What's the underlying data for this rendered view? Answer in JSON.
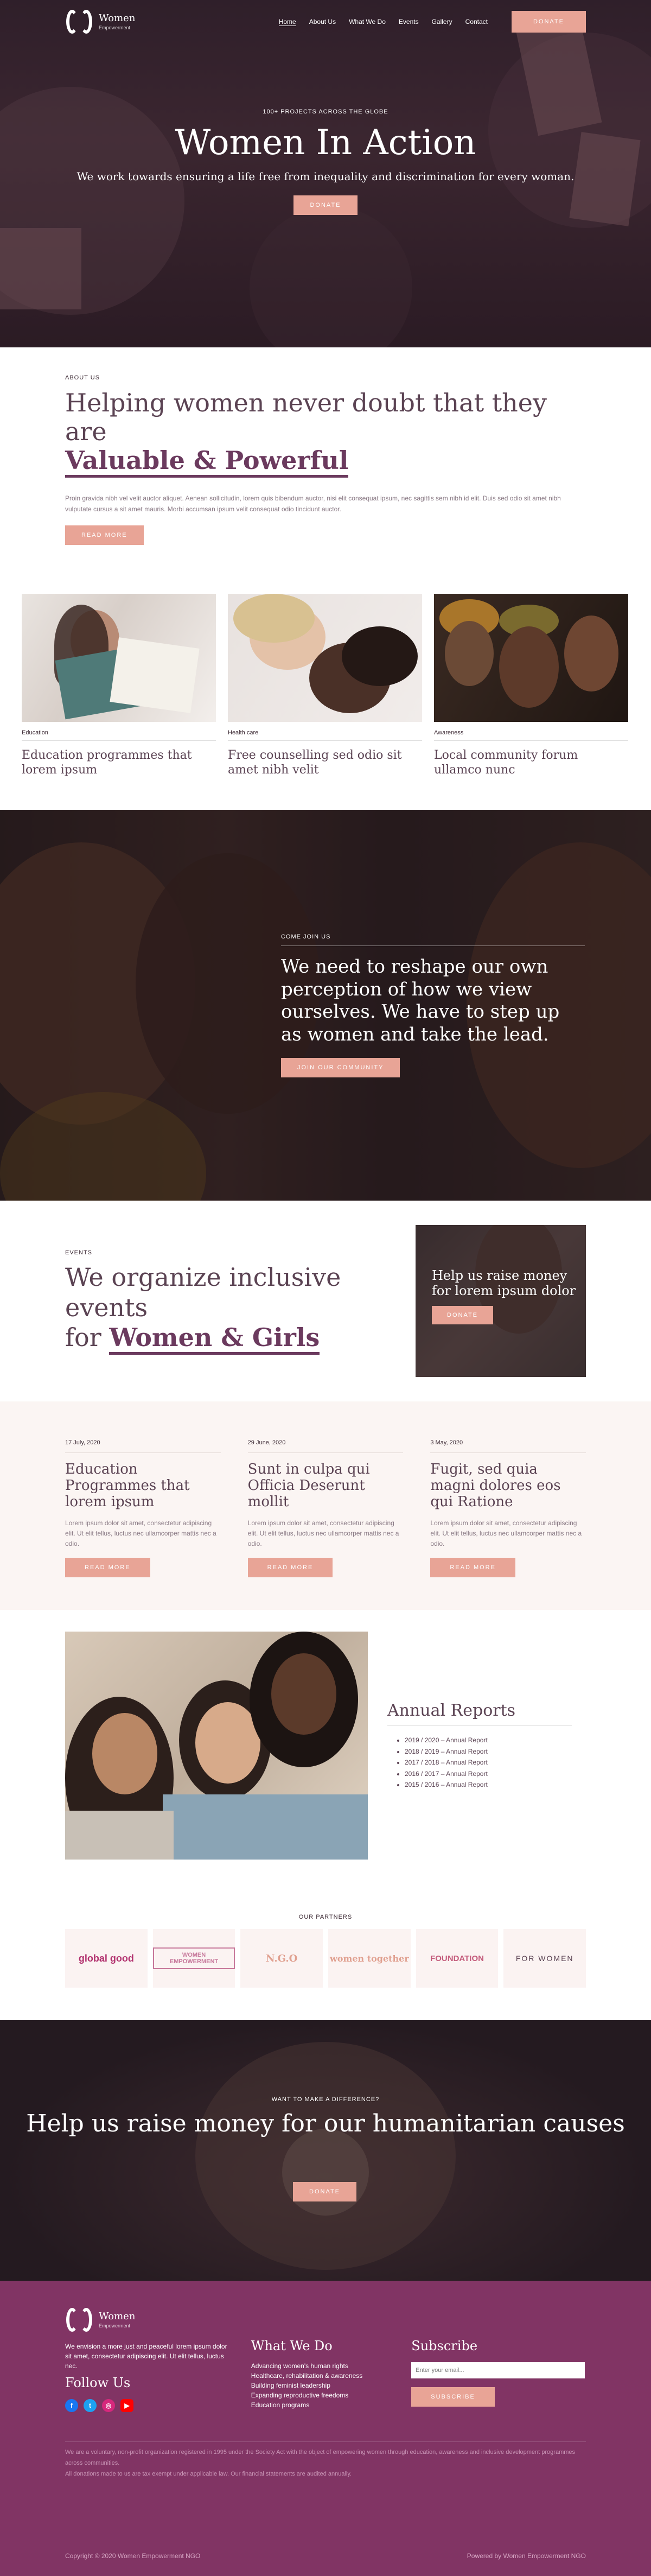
{
  "nav": {
    "brand_name": "Women",
    "brand_tagline": "Empowerment",
    "items": [
      "Home",
      "About Us",
      "What We Do",
      "Events",
      "Gallery",
      "Contact"
    ],
    "donate_label": "Donate"
  },
  "hero": {
    "eyebrow": "100+ PROJECTS ACROSS THE GLOBE",
    "title": "Women In Action",
    "subtitle": "We work towards ensuring a life free from inequality and discrimination for every woman.",
    "button": "Donate"
  },
  "about": {
    "eyebrow": "About Us",
    "title_line1": "Helping women never doubt that they are",
    "title_accent": "Valuable & Powerful",
    "body": "Proin gravida nibh vel velit auctor aliquet. Aenean sollicitudin, lorem quis bibendum auctor, nisi elit consequat ipsum, nec sagittis sem nibh id elit. Duis sed odio sit amet nibh vulputate cursus a sit amet mauris. Morbi accumsan ipsum velit consequat odio tincidunt auctor.",
    "button": "Read More"
  },
  "cards": [
    {
      "category": "Education",
      "title": "Education programmes that lorem ipsum"
    },
    {
      "category": "Health care",
      "title": "Free counselling sed odio sit amet nibh velit"
    },
    {
      "category": "Awareness",
      "title": "Local community forum ullamco nunc"
    }
  ],
  "join": {
    "eyebrow": "Come Join Us",
    "title": "We need to reshape our own perception of how we view ourselves. We have to step up as women and take the lead.",
    "button": "Join our Community"
  },
  "events": {
    "eyebrow": "Events",
    "title_line1": "We organize inclusive events",
    "title_prefix": "for",
    "title_accent": "Women & Girls",
    "box_title": "Help us raise money for lorem ipsum dolor",
    "box_button": "Donate"
  },
  "news": [
    {
      "date": "17 July, 2020",
      "title": "Education Programmes that lorem ipsum",
      "excerpt": "Lorem ipsum dolor sit amet, consectetur adipiscing elit. Ut elit tellus, luctus nec ullamcorper mattis nec a odio.",
      "button": "Read More"
    },
    {
      "date": "29 June, 2020",
      "title": "Sunt in culpa qui Officia Deserunt mollit",
      "excerpt": "Lorem ipsum dolor sit amet, consectetur adipiscing elit. Ut elit tellus, luctus nec ullamcorper mattis nec a odio.",
      "button": "Read More"
    },
    {
      "date": "3 May, 2020",
      "title": "Fugit, sed quia magni dolores eos qui Ratione",
      "excerpt": "Lorem ipsum dolor sit amet, consectetur adipiscing elit. Ut elit tellus, luctus nec ullamcorper mattis nec a odio.",
      "button": "Read More"
    }
  ],
  "reports": {
    "title": "Annual Reports",
    "items": [
      "2019 / 2020 – Annual Report",
      "2018 / 2019 – Annual Report",
      "2017 / 2018 – Annual Report",
      "2016 / 2017 – Annual Report",
      "2015 / 2016 – Annual Report"
    ]
  },
  "partners": {
    "eyebrow": "Our Partners",
    "logos": [
      "global good",
      "WOMEN EMPOWERMENT",
      "N.G.O",
      "women together",
      "FOUNDATION",
      "FOR WOMEN"
    ]
  },
  "cta": {
    "eyebrow": "Want to make a difference?",
    "title": "Help us raise money for our humanitarian causes",
    "button": "Donate"
  },
  "footer": {
    "brand_name": "Women",
    "brand_tagline": "Empowerment",
    "about": "We envision a more just and peaceful lorem ipsum dolor sit amet, consectetur adipiscing elit. Ut elit tellus, luctus nec.",
    "follow_title": "Follow Us",
    "what_we_do_title": "What We Do",
    "what_we_do_items": [
      "Advancing women's human rights",
      "Healthcare, rehabilitation & awareness",
      "Building feminist leadership",
      "Expanding reproductive freedoms",
      "Education programs"
    ],
    "subscribe_title": "Subscribe",
    "email_placeholder": "Enter your email...",
    "subscribe_button": "Subscribe",
    "legal_1": "We are a voluntary, non-profit organization registered in 1995 under the Society Act with the object of empowering women through education, awareness and inclusive development programmes across communities.",
    "legal_2": "All donations made to us are tax exempt under applicable law. Our financial statements are audited annually.",
    "copyright": "Copyright © 2020 Women Empowerment NGO",
    "powered": "Powered by Women Empowerment NGO"
  },
  "colors": {
    "accent": "#e8a496",
    "brand": "#813464",
    "heading": "#5b4353"
  }
}
